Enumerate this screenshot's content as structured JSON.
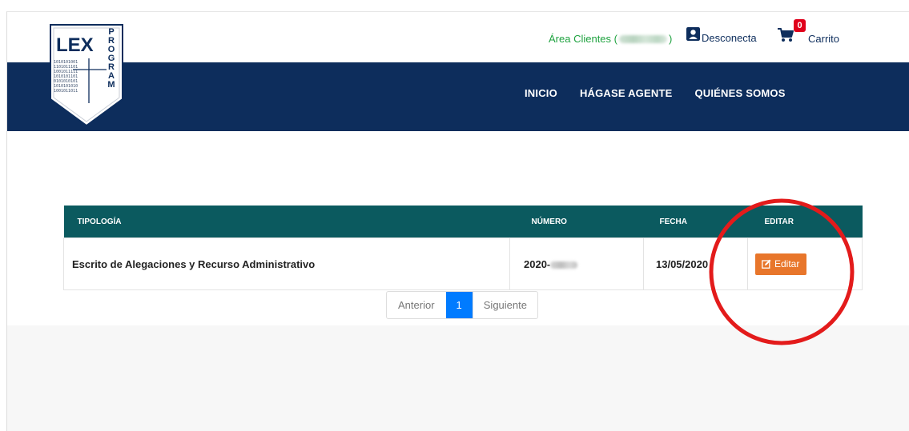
{
  "logo": {
    "text_main": "LEX",
    "text_side": [
      "P",
      "R",
      "O",
      "G",
      "R",
      "A",
      "M"
    ],
    "binary_rows": [
      "1010101001",
      "1101011101",
      "1001011111",
      "1010101101",
      "0101010101",
      "1010101010",
      "1001011011"
    ]
  },
  "header": {
    "area_label_prefix": "Área Clientes (",
    "area_label_suffix": ")",
    "disconnect_label": "Desconecta",
    "cart_label": "Carrito",
    "cart_count": "0"
  },
  "nav": {
    "items": [
      "INICIO",
      "HÁGASE AGENTE",
      "QUIÉNES SOMOS"
    ]
  },
  "table": {
    "headers": [
      "TIPOLOGÍA",
      "NÚMERO",
      "FECHA",
      "EDITAR"
    ],
    "rows": [
      {
        "tipologia": "Escrito de Alegaciones y Recurso Administrativo",
        "numero_prefix": "2020-",
        "fecha": "13/05/2020",
        "editar": "Editar"
      }
    ]
  },
  "pagination": {
    "prev": "Anterior",
    "current": "1",
    "next": "Siguiente"
  },
  "colors": {
    "navy": "#0d2d5c",
    "teal_header": "#0b5a5f",
    "orange_button": "#e8762b",
    "green_text": "#1ea23f",
    "badge_red": "#e0001b",
    "page_blue": "#007bff",
    "annotation_red": "#e31b1b"
  }
}
